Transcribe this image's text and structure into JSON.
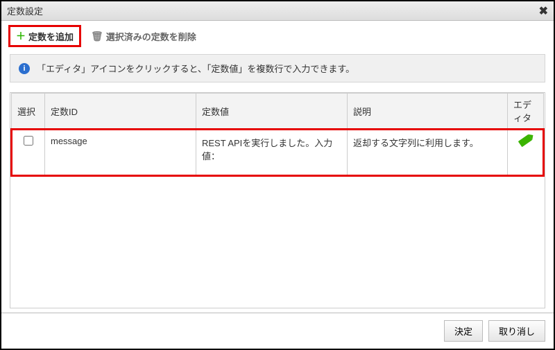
{
  "dialog": {
    "title": "定数設定",
    "close_label": "✖"
  },
  "toolbar": {
    "add_label": "定数を追加",
    "delete_label": "選択済みの定数を削除"
  },
  "info": {
    "text": "「エディタ」アイコンをクリックすると、「定数値」を複数行で入力できます。"
  },
  "table": {
    "headers": {
      "select": "選択",
      "id": "定数ID",
      "value": "定数値",
      "desc": "説明",
      "editor": "エディタ"
    },
    "rows": [
      {
        "id": "message",
        "value": "REST APIを実行しました。入力値：",
        "desc": "返却する文字列に利用します。"
      }
    ]
  },
  "footer": {
    "ok": "決定",
    "cancel": "取り消し"
  }
}
